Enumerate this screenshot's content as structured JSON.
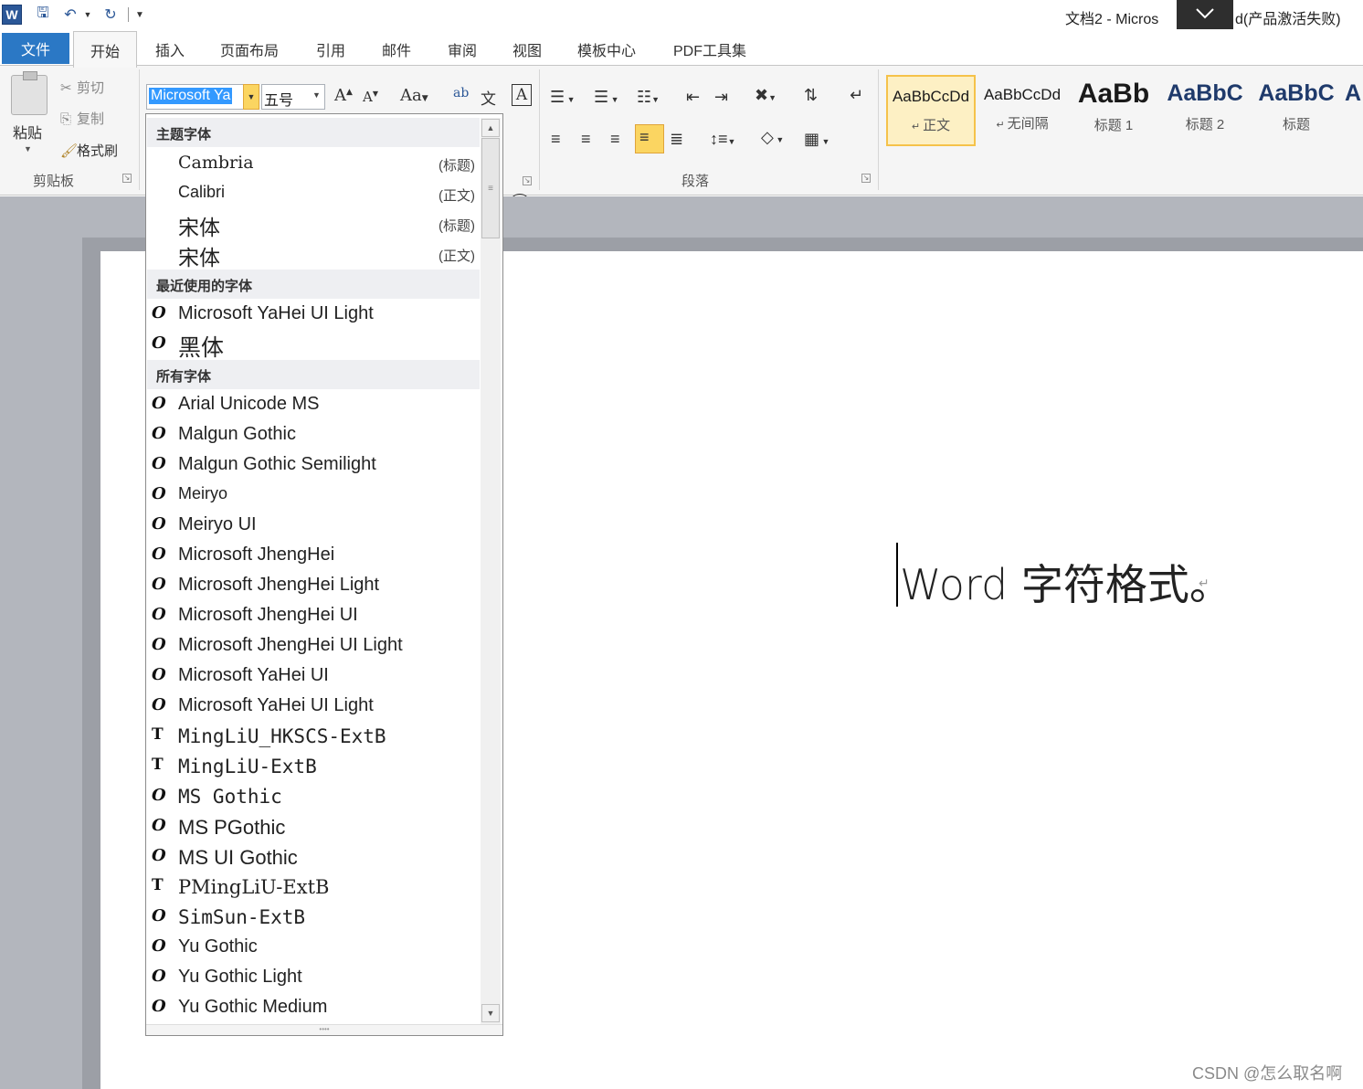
{
  "titlebar": {
    "app_logo": "W",
    "title": "文档2 - Micros",
    "title_tail": "d(产品激活失败)",
    "icons": [
      "word-logo-icon",
      "save-icon",
      "undo-icon",
      "redo-icon",
      "customize-icon",
      "ribbon-collapse-icon"
    ]
  },
  "tabs": {
    "file": "文件",
    "home": "开始",
    "items": [
      "插入",
      "页面布局",
      "引用",
      "邮件",
      "审阅",
      "视图",
      "模板中心",
      "PDF工具集"
    ]
  },
  "clipboard": {
    "paste": "粘贴",
    "cut": "剪切",
    "copy": "复制",
    "format_painter": "格式刷",
    "group_label": "剪贴板"
  },
  "font": {
    "name": "Microsoft Ya",
    "size": "五号",
    "grow": "A",
    "shrink": "A",
    "case": "Aa",
    "phonetic": "ab",
    "char_border": "A",
    "enclose": "字"
  },
  "paragraph": {
    "group_label": "段落"
  },
  "styles": {
    "items": [
      {
        "sample": "AaBbCcDd",
        "name": "正文"
      },
      {
        "sample": "AaBbCcDd",
        "name": "无间隔"
      },
      {
        "sample": "AaBb",
        "name": "标题 1"
      },
      {
        "sample": "AaBbC",
        "name": "标题 2"
      },
      {
        "sample": "AaBbC",
        "name": "标题"
      },
      {
        "sample": "A",
        "name": ""
      }
    ]
  },
  "document": {
    "text": "Word 字符格式。",
    "para_mark": "↵"
  },
  "font_dropdown": {
    "headers": {
      "theme": "主题字体",
      "recent": "最近使用的字体",
      "all": "所有字体"
    },
    "theme_fonts": [
      {
        "name": "Cambria",
        "tag": "(标题)"
      },
      {
        "name": "Calibri",
        "tag": "(正文)"
      },
      {
        "name": "宋体",
        "tag": "(标题)"
      },
      {
        "name": "宋体",
        "tag": "(正文)"
      }
    ],
    "recent_fonts": [
      "Microsoft YaHei UI Light",
      "黑体"
    ],
    "all_fonts": [
      "Arial Unicode MS",
      "Malgun Gothic",
      "Malgun Gothic Semilight",
      "Meiryo",
      "Meiryo UI",
      "Microsoft JhengHei",
      "Microsoft JhengHei Light",
      "Microsoft JhengHei UI",
      "Microsoft JhengHei UI Light",
      "Microsoft YaHei UI",
      "Microsoft YaHei UI Light",
      "MingLiU_HKSCS-ExtB",
      "MingLiU-ExtB",
      "MS Gothic",
      "MS PGothic",
      "MS UI Gothic",
      "PMingLiU-ExtB",
      "SimSun-ExtB",
      "Yu Gothic",
      "Yu Gothic Light",
      "Yu Gothic Medium"
    ]
  },
  "watermark": "CSDN @怎么取名啊",
  "colors": {
    "file_tab": "#2b78c5",
    "selection": "#3399ff",
    "highlight": "#fbd561",
    "ribbon_bg": "#f5f5f5",
    "workspace": "#b3b6bd"
  }
}
